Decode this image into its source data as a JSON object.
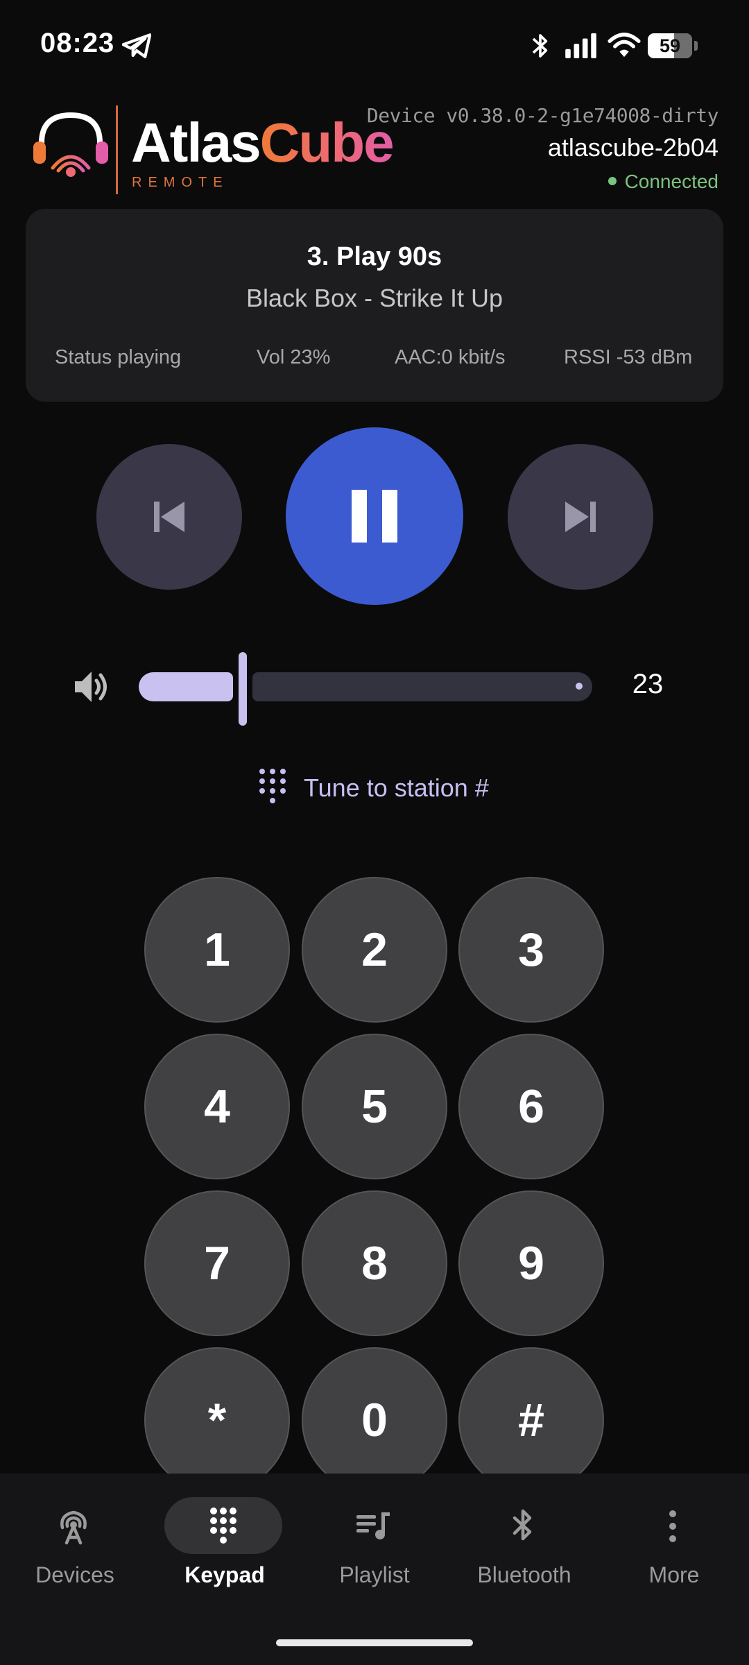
{
  "status_bar": {
    "time": "08:23",
    "battery_level": "59",
    "icons": [
      "telegram-icon",
      "bluetooth-icon",
      "signal-icon",
      "wifi-icon",
      "battery-icon"
    ]
  },
  "header": {
    "logo_word_1": "Atlas",
    "logo_word_2": "Cube",
    "logo_subtitle": "REMOTE",
    "device_version": "Device v0.38.0-2-g1e74008-dirty",
    "device_name": "atlascube-2b04",
    "connection_status": "Connected",
    "connection_color": "#7bc47f"
  },
  "now_playing": {
    "station": "3. Play 90s",
    "track": "Black Box - Strike It Up",
    "stats": {
      "status": "Status playing",
      "volume": "Vol 23%",
      "codec": "AAC:0 kbit/s",
      "rssi": "RSSI -53 dBm"
    }
  },
  "transport": {
    "icons": [
      "skip-previous-icon",
      "pause-icon",
      "skip-next-icon"
    ],
    "accent_color": "#3d5bd0"
  },
  "volume": {
    "value": "23",
    "level": 0.23,
    "icon": "speaker-icon"
  },
  "tune": {
    "label": "Tune to station #",
    "icon": "dialpad-icon"
  },
  "keypad": {
    "keys": [
      "1",
      "2",
      "3",
      "4",
      "5",
      "6",
      "7",
      "8",
      "9",
      "*",
      "0",
      "#"
    ]
  },
  "nav": {
    "active": "Keypad",
    "items": [
      {
        "label": "Devices",
        "icon": "antenna-icon"
      },
      {
        "label": "Keypad",
        "icon": "dialpad-icon"
      },
      {
        "label": "Playlist",
        "icon": "playlist-music-icon"
      },
      {
        "label": "Bluetooth",
        "icon": "bluetooth-icon"
      },
      {
        "label": "More",
        "icon": "more-vertical-icon"
      }
    ]
  }
}
